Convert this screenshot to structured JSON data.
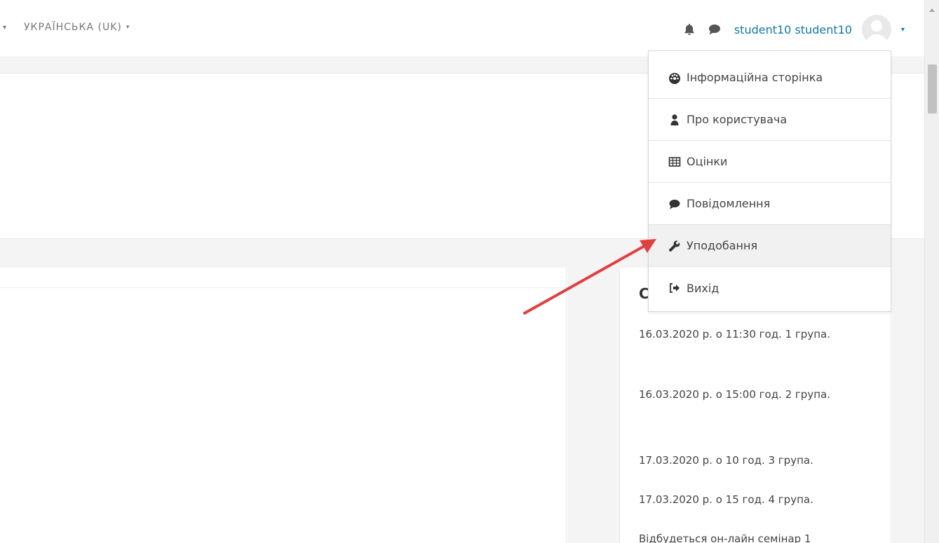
{
  "header": {
    "language_label": "УКРАЇНСЬКА (UK)",
    "user_name": "student10 student10"
  },
  "user_menu": {
    "items": [
      {
        "label": "Інформаційна сторінка",
        "icon": "dashboard-icon"
      },
      {
        "label": "Про користувача",
        "icon": "user-icon"
      },
      {
        "label": "Оцінки",
        "icon": "table-icon"
      },
      {
        "label": "Повідомлення",
        "icon": "comment-icon"
      },
      {
        "label": "Уподобання",
        "icon": "wrench-icon"
      },
      {
        "label": "Вихід",
        "icon": "sign-out-icon"
      }
    ],
    "active_item": "Уподобання"
  },
  "sidebar_block": {
    "heading_fragment": "С",
    "items": [
      "16.03.2020 р. о 11:30 год. 1 група.",
      "16.03.2020 р. о 15:00 год. 2 група.",
      "17.03.2020 р. о 10 год. 3 група.",
      "17.03.2020 р. о 15 год. 4 група.",
      "Відбудеться он-лайн семінар 1"
    ]
  },
  "colors": {
    "link": "#1177a8",
    "arrow": "#e0403f",
    "menu_active_bg": "#f1f1f1"
  }
}
